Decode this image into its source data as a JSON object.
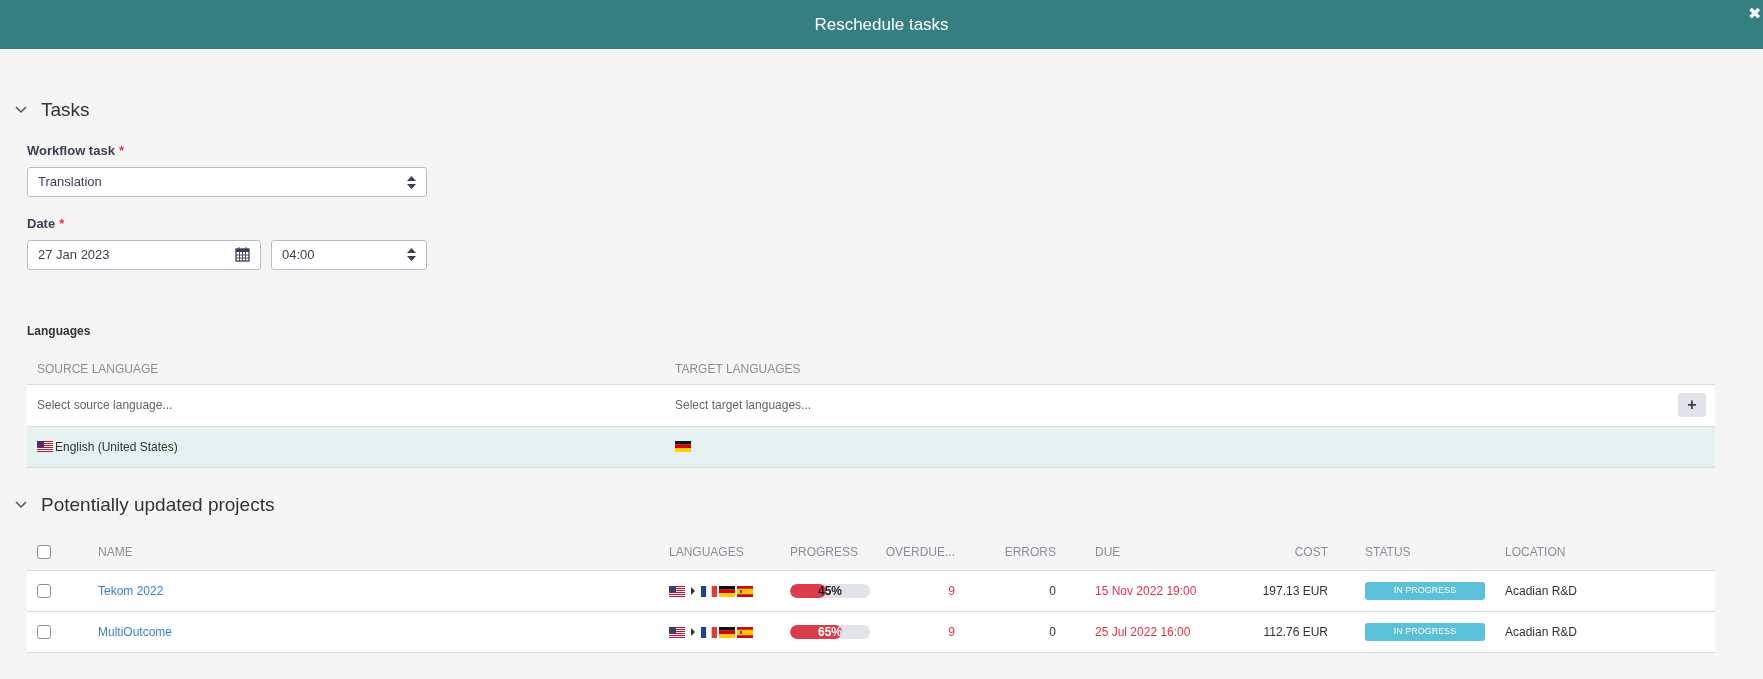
{
  "dialog": {
    "title": "Reschedule tasks",
    "close": "✖"
  },
  "tasks_section": {
    "title": "Tasks",
    "expanded": true,
    "workflow_task": {
      "label": "Workflow task",
      "required_mark": "*",
      "value": "Translation"
    },
    "date": {
      "label": "Date",
      "required_mark": "*",
      "date_value": "27 Jan 2023",
      "time_value": "04:00"
    }
  },
  "languages": {
    "title": "Languages",
    "columns": [
      "SOURCE LANGUAGE",
      "TARGET LANGUAGES"
    ],
    "source_placeholder": "Select source language...",
    "target_placeholder": "Select target languages...",
    "add_button": "+",
    "rows": [
      {
        "source_flag": {
          "kind": "us"
        },
        "source": "English (United States)",
        "target_flags": [
          {
            "kind": "de"
          }
        ]
      }
    ]
  },
  "projects_section": {
    "title": "Potentially updated projects",
    "expanded": true,
    "select_all_checked": false,
    "columns": [
      "NAME",
      "LANGUAGES",
      "PROGRESS",
      "OVERDUE...",
      "ERRORS",
      "DUE",
      "COST",
      "STATUS",
      "LOCATION"
    ],
    "rows": [
      {
        "checked": false,
        "name": "Tekom 2022",
        "source_flag": {
          "kind": "us"
        },
        "target_flags": [
          {
            "kind": "fr"
          },
          {
            "kind": "de"
          },
          {
            "kind": "es"
          }
        ],
        "level": 0.45,
        "progress": "45%",
        "overdue": "9",
        "errors": "0",
        "due": "15 Nov 2022 19:00",
        "cost": "197.13 EUR",
        "status": "IN PROGRESS",
        "location": "Acadian R&D"
      },
      {
        "checked": false,
        "name": "MultiOutcome",
        "source_flag": {
          "kind": "us"
        },
        "target_flags": [
          {
            "kind": "fr"
          },
          {
            "kind": "de"
          },
          {
            "kind": "es"
          }
        ],
        "level": 0.65,
        "progress": "65%",
        "overdue": "9",
        "errors": "0",
        "due": "25 Jul 2022 16:00",
        "cost": "112.76 EUR",
        "status": "IN PROGRESS",
        "location": "Acadian R&D"
      }
    ]
  }
}
